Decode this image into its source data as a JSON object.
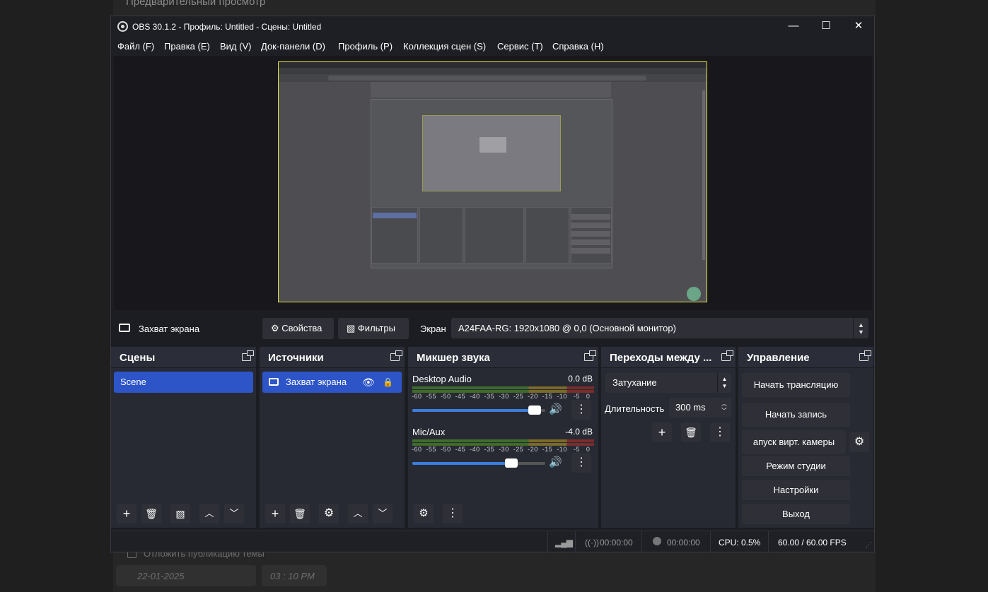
{
  "background": {
    "top_text": "Предварительный просмотр",
    "checkbox_label": "Отложить публикацию темы",
    "date_value": "22-01-2025",
    "time_value": "03 : 10  PM"
  },
  "window": {
    "title": "OBS 30.1.2 - Профиль: Untitled - Сцены: Untitled",
    "minimize": "—",
    "maximize": "☐",
    "close": "✕"
  },
  "menu": [
    "Файл (F)",
    "Правка (E)",
    "Вид (V)",
    "Док-панели (D)",
    "Профиль (P)",
    "Коллекция сцен (S)",
    "Сервис (T)",
    "Справка (H)"
  ],
  "source_bar": {
    "source_name": "Захват экрана",
    "properties": "Свойства",
    "filters": "Фильтры",
    "display_label": "Экран",
    "display_value": "A24FAA-RG: 1920x1080 @ 0,0 (Основной монитор)"
  },
  "scenes": {
    "title": "Сцены",
    "items": [
      "Scene"
    ]
  },
  "sources": {
    "title": "Источники",
    "items": [
      "Захват экрана"
    ]
  },
  "mixer": {
    "title": "Микшер звука",
    "channels": [
      {
        "name": "Desktop Audio",
        "db": "0.0 dB",
        "level": 0.97
      },
      {
        "name": "Mic/Aux",
        "db": "-4.0 dB",
        "level": 0.79
      }
    ],
    "scale": [
      "-60",
      "-55",
      "-50",
      "-45",
      "-40",
      "-35",
      "-30",
      "-25",
      "-20",
      "-15",
      "-10",
      "-5",
      "0"
    ]
  },
  "transitions": {
    "title": "Переходы между ...",
    "type": "Затухание",
    "duration_label": "Длительность",
    "duration_value": "300 ms"
  },
  "controls": {
    "title": "Управление",
    "start_stream": "Начать трансляцию",
    "start_record": "Начать запись",
    "virtual_cam": "апуск вирт. камеры",
    "studio_mode": "Режим студии",
    "settings": "Настройки",
    "exit": "Выход"
  },
  "status": {
    "stream_time": "00:00:00",
    "record_time": "00:00:00",
    "cpu": "CPU: 0.5%",
    "fps": "60.00 / 60.00 FPS"
  },
  "colors": {
    "accent": "#2d55c8",
    "dock": "#272a33",
    "button": "#2f3037"
  }
}
